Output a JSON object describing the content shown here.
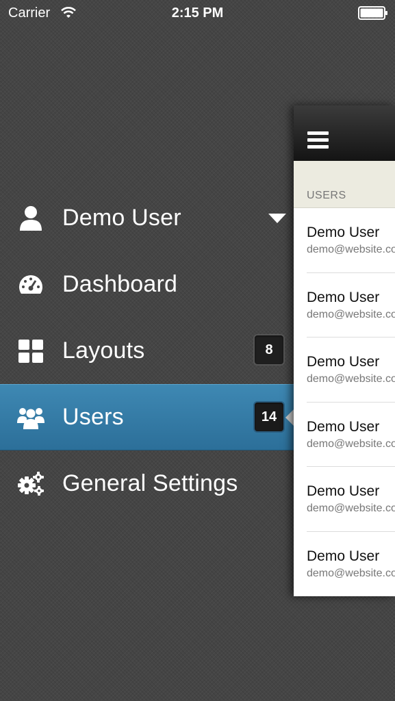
{
  "status_bar": {
    "carrier": "Carrier",
    "time": "2:15 PM"
  },
  "menu": {
    "items": [
      {
        "label": "Demo User",
        "icon": "user-icon",
        "has_dropdown": true
      },
      {
        "label": "Dashboard",
        "icon": "speedometer-icon"
      },
      {
        "label": "Layouts",
        "icon": "grid-icon",
        "badge": "8"
      },
      {
        "label": "Users",
        "icon": "users-icon",
        "badge": "14",
        "active": true
      },
      {
        "label": "General Settings",
        "icon": "gears-icon"
      }
    ]
  },
  "panel": {
    "section_title": "USERS",
    "users": [
      {
        "name": "Demo User",
        "email": "demo@website.com"
      },
      {
        "name": "Demo User",
        "email": "demo@website.com"
      },
      {
        "name": "Demo User",
        "email": "demo@website.com"
      },
      {
        "name": "Demo User",
        "email": "demo@website.com"
      },
      {
        "name": "Demo User",
        "email": "demo@website.com"
      },
      {
        "name": "Demo User",
        "email": "demo@website.com"
      }
    ]
  },
  "colors": {
    "background": "#454545",
    "active_item": "#3e88b3",
    "section_header": "#ecebe0"
  }
}
